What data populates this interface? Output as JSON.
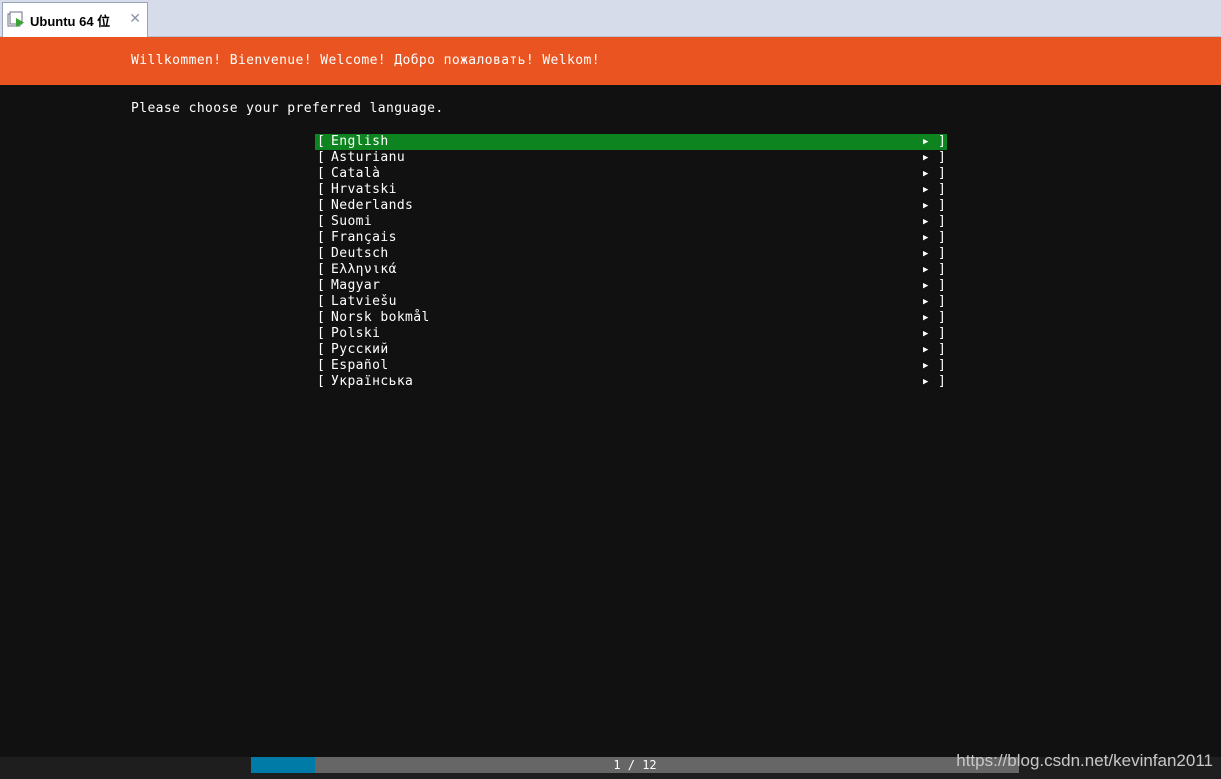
{
  "vm_tab": {
    "title": "Ubuntu 64 位",
    "icon": "vm-play-icon",
    "close_icon": "close-icon",
    "close_glyph": "✕"
  },
  "installer": {
    "header": "Willkommen! Bienvenue! Welcome! Добро пожаловать! Welkom!",
    "prompt": "Please choose your preferred language.",
    "languages": [
      "English",
      "Asturianu",
      "Català",
      "Hrvatski",
      "Nederlands",
      "Suomi",
      "Français",
      "Deutsch",
      "Ελληνικά",
      "Magyar",
      "Latviešu",
      "Norsk bokmål",
      "Polski",
      "Русский",
      "Español",
      "Українська"
    ],
    "selected_index": 0,
    "bracket_open": "[",
    "bracket_close": "]",
    "arrow_glyph": "▶",
    "progress": {
      "label": "1 / 12",
      "current": 1,
      "total": 12
    }
  },
  "colors": {
    "header_bg": "#e95420",
    "console_bg": "#111111",
    "selected_bg": "#0e8420",
    "progress_fill": "#007aa6",
    "progress_track": "#666666",
    "tabbar_bg": "#d6dcea"
  },
  "watermark": "https://blog.csdn.net/kevinfan2011"
}
